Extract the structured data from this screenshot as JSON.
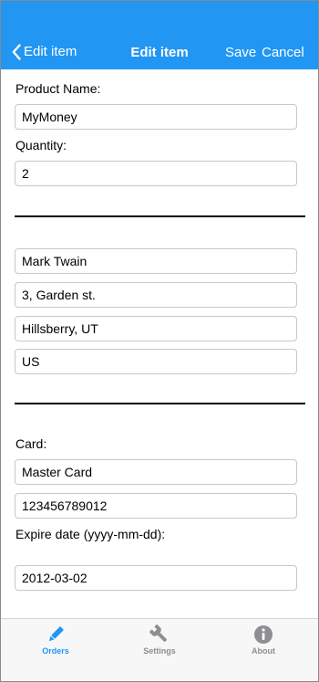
{
  "header": {
    "back_label": "Edit item",
    "title": "Edit item",
    "save_label": "Save",
    "cancel_label": "Cancel",
    "background_color": "#2196f3",
    "text_color": "#ffffff"
  },
  "product": {
    "name_label": "Product Name:",
    "name_value": "MyMoney",
    "quantity_label": "Quantity:",
    "quantity_value": "2"
  },
  "address": {
    "name": "Mark Twain",
    "street": "3, Garden st.",
    "city_state": "Hillsberry, UT",
    "country": "US"
  },
  "payment": {
    "card_label": "Card:",
    "card_type": "Master Card",
    "card_number": "123456789012",
    "expire_label": "Expire date (yyyy-mm-dd):",
    "expire_value": "2012-03-02"
  },
  "tabbar": {
    "active_color": "#2196f3",
    "inactive_color": "#8e8e93",
    "tabs": [
      {
        "label": "Orders",
        "icon": "pencil-icon",
        "active": true
      },
      {
        "label": "Settings",
        "icon": "wrench-icon",
        "active": false
      },
      {
        "label": "About",
        "icon": "info-icon",
        "active": false
      }
    ]
  }
}
